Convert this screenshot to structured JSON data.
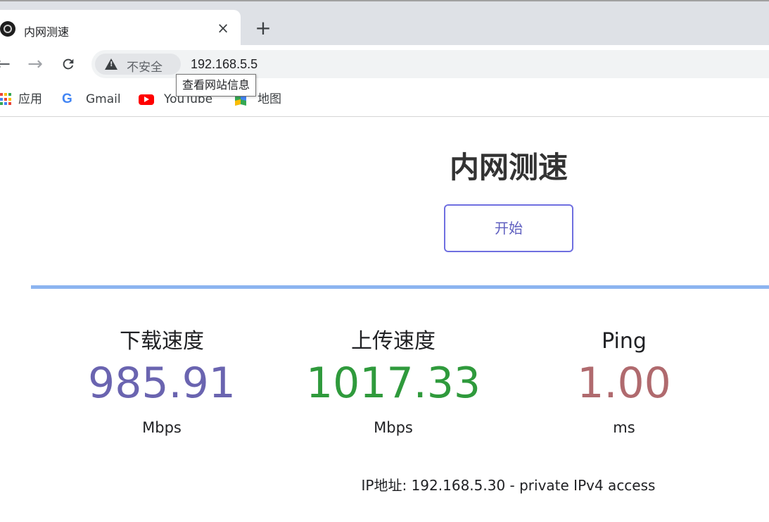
{
  "browser": {
    "tab": {
      "title": "内网测速",
      "close_glyph": "×",
      "favicon": "speedtest-icon"
    },
    "new_tab_glyph": "+",
    "nav": {
      "back_glyph": "←",
      "forward_glyph": "→",
      "reload_glyph": "C"
    },
    "address": {
      "security_label": "不安全",
      "url": "192.168.5.5",
      "tooltip": "查看网站信息"
    },
    "bookmarks": [
      {
        "label": "应用",
        "icon": "apps-grid-icon"
      },
      {
        "label": "Gmail",
        "icon": "google-icon"
      },
      {
        "label": "YouTube",
        "icon": "youtube-icon"
      },
      {
        "label": "地图",
        "icon": "maps-icon"
      }
    ]
  },
  "page": {
    "title": "内网测速",
    "start_button": "开始",
    "progress": 1.0,
    "metrics": {
      "download": {
        "label": "下载速度",
        "value": "985.91",
        "unit": "Mbps",
        "color": "#6a64b0"
      },
      "upload": {
        "label": "上传速度",
        "value": "1017.33",
        "unit": "Mbps",
        "color": "#2f9a3c"
      },
      "ping": {
        "label": "Ping",
        "value": "1.00",
        "unit": "ms",
        "color": "#b06a6e"
      }
    },
    "ip_info": "IP地址: 192.168.5.30 - private IPv4 access"
  },
  "colors": {
    "accent_button": "#6f6fe0",
    "progress_bar": "#8cb4f0"
  }
}
